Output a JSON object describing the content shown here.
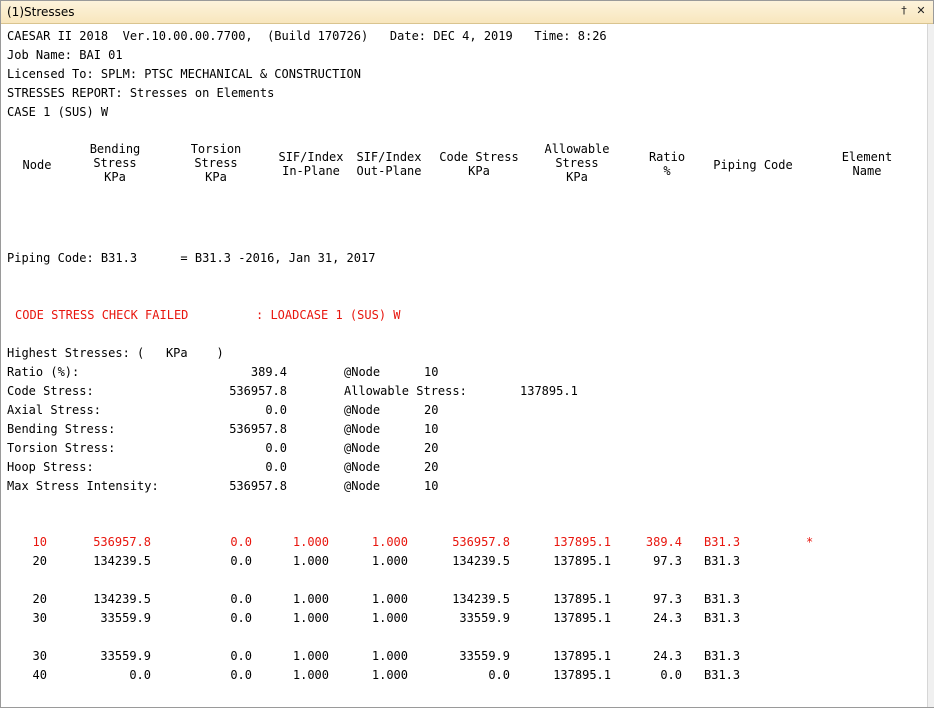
{
  "window": {
    "title": "(1)Stresses",
    "pin_glyph": "†",
    "close_glyph": "✕"
  },
  "report_header": {
    "line1": "CAESAR II 2018  Ver.10.00.00.7700,  (Build 170726)   Date: DEC 4, 2019   Time: 8:26",
    "line2": "Job Name: BAI 01",
    "line3": "Licensed To: SPLM: PTSC MECHANICAL & CONSTRUCTION",
    "line4": "STRESSES REPORT: Stresses on Elements",
    "line5": "CASE 1 (SUS) W"
  },
  "columns": [
    "Node",
    "Bending\nStress\nKPa",
    "Torsion\nStress\nKPa",
    "SIF/Index\nIn-Plane",
    "SIF/Index\nOut-Plane",
    "Code Stress\nKPa",
    "Allowable\nStress\nKPa",
    "Ratio\n%",
    "Piping Code",
    "Element\nName"
  ],
  "piping_code_line": "Piping Code: B31.3      = B31.3 -2016, Jan 31, 2017",
  "check_failed": {
    "left": "CODE STRESS CHECK FAILED",
    "right": ": LOADCASE 1 (SUS) W"
  },
  "highest": {
    "title": "Highest Stresses: (   KPa    )",
    "rows": [
      {
        "label": "Ratio (%):",
        "value": "389.4",
        "at": "@Node",
        "node": "10"
      },
      {
        "label": "Code Stress:",
        "value": "536957.8",
        "at": "Allowable Stress:",
        "node": "137895.1"
      },
      {
        "label": "Axial Stress:",
        "value": "0.0",
        "at": "@Node",
        "node": "20"
      },
      {
        "label": "Bending Stress:",
        "value": "536957.8",
        "at": "@Node",
        "node": "10"
      },
      {
        "label": "Torsion Stress:",
        "value": "0.0",
        "at": "@Node",
        "node": "20"
      },
      {
        "label": "Hoop Stress:",
        "value": "0.0",
        "at": "@Node",
        "node": "20"
      },
      {
        "label": "Max Stress Intensity:",
        "value": "536957.8",
        "at": "@Node",
        "node": "10"
      }
    ]
  },
  "elements": [
    {
      "node": "10",
      "bending": "536957.8",
      "torsion": "0.0",
      "sif_in": "1.000",
      "sif_out": "1.000",
      "code": "536957.8",
      "allow": "137895.1",
      "ratio": "389.4",
      "piping": "B31.3",
      "flag": "*",
      "failed": true,
      "group": 0
    },
    {
      "node": "20",
      "bending": "134239.5",
      "torsion": "0.0",
      "sif_in": "1.000",
      "sif_out": "1.000",
      "code": "134239.5",
      "allow": "137895.1",
      "ratio": "97.3",
      "piping": "B31.3",
      "flag": "",
      "failed": false,
      "group": 0
    },
    {
      "node": "20",
      "bending": "134239.5",
      "torsion": "0.0",
      "sif_in": "1.000",
      "sif_out": "1.000",
      "code": "134239.5",
      "allow": "137895.1",
      "ratio": "97.3",
      "piping": "B31.3",
      "flag": "",
      "failed": false,
      "group": 1
    },
    {
      "node": "30",
      "bending": "33559.9",
      "torsion": "0.0",
      "sif_in": "1.000",
      "sif_out": "1.000",
      "code": "33559.9",
      "allow": "137895.1",
      "ratio": "24.3",
      "piping": "B31.3",
      "flag": "",
      "failed": false,
      "group": 1
    },
    {
      "node": "30",
      "bending": "33559.9",
      "torsion": "0.0",
      "sif_in": "1.000",
      "sif_out": "1.000",
      "code": "33559.9",
      "allow": "137895.1",
      "ratio": "24.3",
      "piping": "B31.3",
      "flag": "",
      "failed": false,
      "group": 2
    },
    {
      "node": "40",
      "bending": "0.0",
      "torsion": "0.0",
      "sif_in": "1.000",
      "sif_out": "1.000",
      "code": "0.0",
      "allow": "137895.1",
      "ratio": "0.0",
      "piping": "B31.3",
      "flag": "",
      "failed": false,
      "group": 2
    }
  ]
}
